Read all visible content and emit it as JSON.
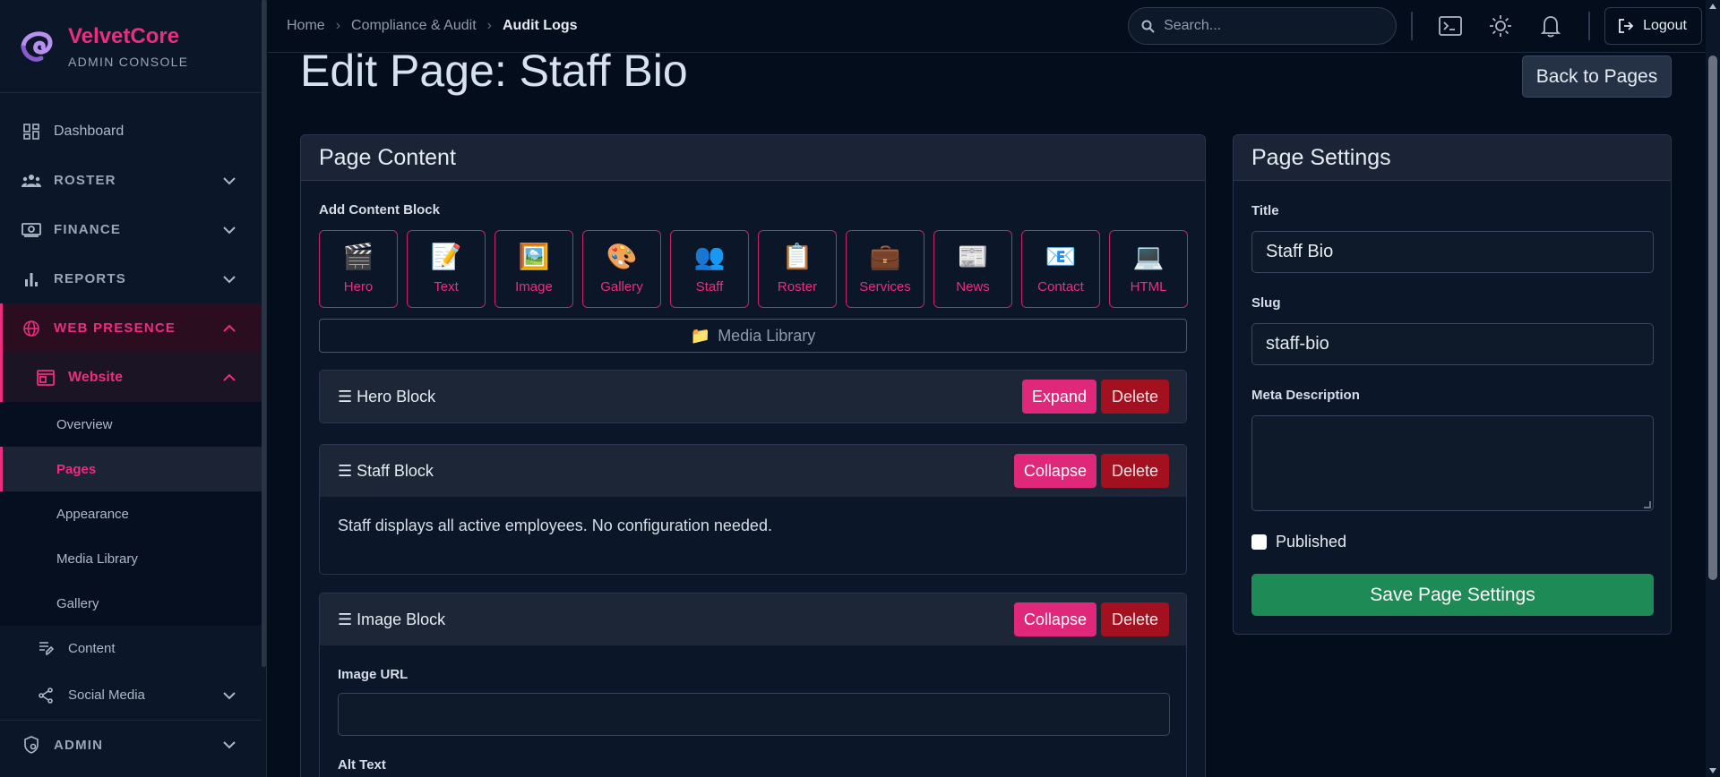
{
  "brand": {
    "name": "VelvetCore",
    "subtitle": "ADMIN CONSOLE"
  },
  "sidebar": {
    "items": [
      {
        "label": "Dashboard",
        "icon": "dashboard-icon"
      },
      {
        "label": "ROSTER",
        "icon": "users-icon"
      },
      {
        "label": "FINANCE",
        "icon": "money-icon"
      },
      {
        "label": "REPORTS",
        "icon": "bar-chart-icon"
      },
      {
        "label": "WEB PRESENCE",
        "icon": "globe-icon"
      },
      {
        "label": "Website",
        "icon": "browser-icon"
      },
      {
        "label": "Content",
        "icon": "edit-list-icon"
      },
      {
        "label": "Social Media",
        "icon": "share-icon"
      },
      {
        "label": "ADMIN",
        "icon": "shield-icon"
      }
    ],
    "website_sub": [
      "Overview",
      "Pages",
      "Appearance",
      "Media Library",
      "Gallery"
    ]
  },
  "topbar": {
    "breadcrumbs": [
      "Home",
      "Compliance & Audit",
      "Audit Logs"
    ],
    "search_placeholder": "Search...",
    "logout": "Logout"
  },
  "page": {
    "title": "Edit Page: Staff Bio",
    "back": "Back to Pages"
  },
  "content": {
    "header": "Page Content",
    "add_label": "Add Content Block",
    "block_types": [
      {
        "label": "Hero",
        "emoji": "🎬"
      },
      {
        "label": "Text",
        "emoji": "📝"
      },
      {
        "label": "Image",
        "emoji": "🖼️"
      },
      {
        "label": "Gallery",
        "emoji": "🎨"
      },
      {
        "label": "Staff",
        "emoji": "👥"
      },
      {
        "label": "Roster",
        "emoji": "📋"
      },
      {
        "label": "Services",
        "emoji": "💼"
      },
      {
        "label": "News",
        "emoji": "📰"
      },
      {
        "label": "Contact",
        "emoji": "📧"
      },
      {
        "label": "HTML",
        "emoji": "💻"
      }
    ],
    "media_library": "Media Library",
    "blocks": [
      {
        "title": "☰ Hero Block",
        "toggle": "Expand",
        "delete": "Delete"
      },
      {
        "title": "☰ Staff Block",
        "toggle": "Collapse",
        "delete": "Delete",
        "body": "Staff displays all active employees. No configuration needed."
      },
      {
        "title": "☰ Image Block",
        "toggle": "Collapse",
        "delete": "Delete",
        "fields": [
          "Image URL",
          "Alt Text"
        ]
      }
    ]
  },
  "settings": {
    "header": "Page Settings",
    "title_label": "Title",
    "title_value": "Staff Bio",
    "slug_label": "Slug",
    "slug_value": "staff-bio",
    "meta_label": "Meta Description",
    "published_label": "Published",
    "save": "Save Page Settings"
  },
  "colors": {
    "accent": "#ec2d7e",
    "danger": "#a31020",
    "success": "#1e8a55",
    "bg": "#040d1c"
  }
}
